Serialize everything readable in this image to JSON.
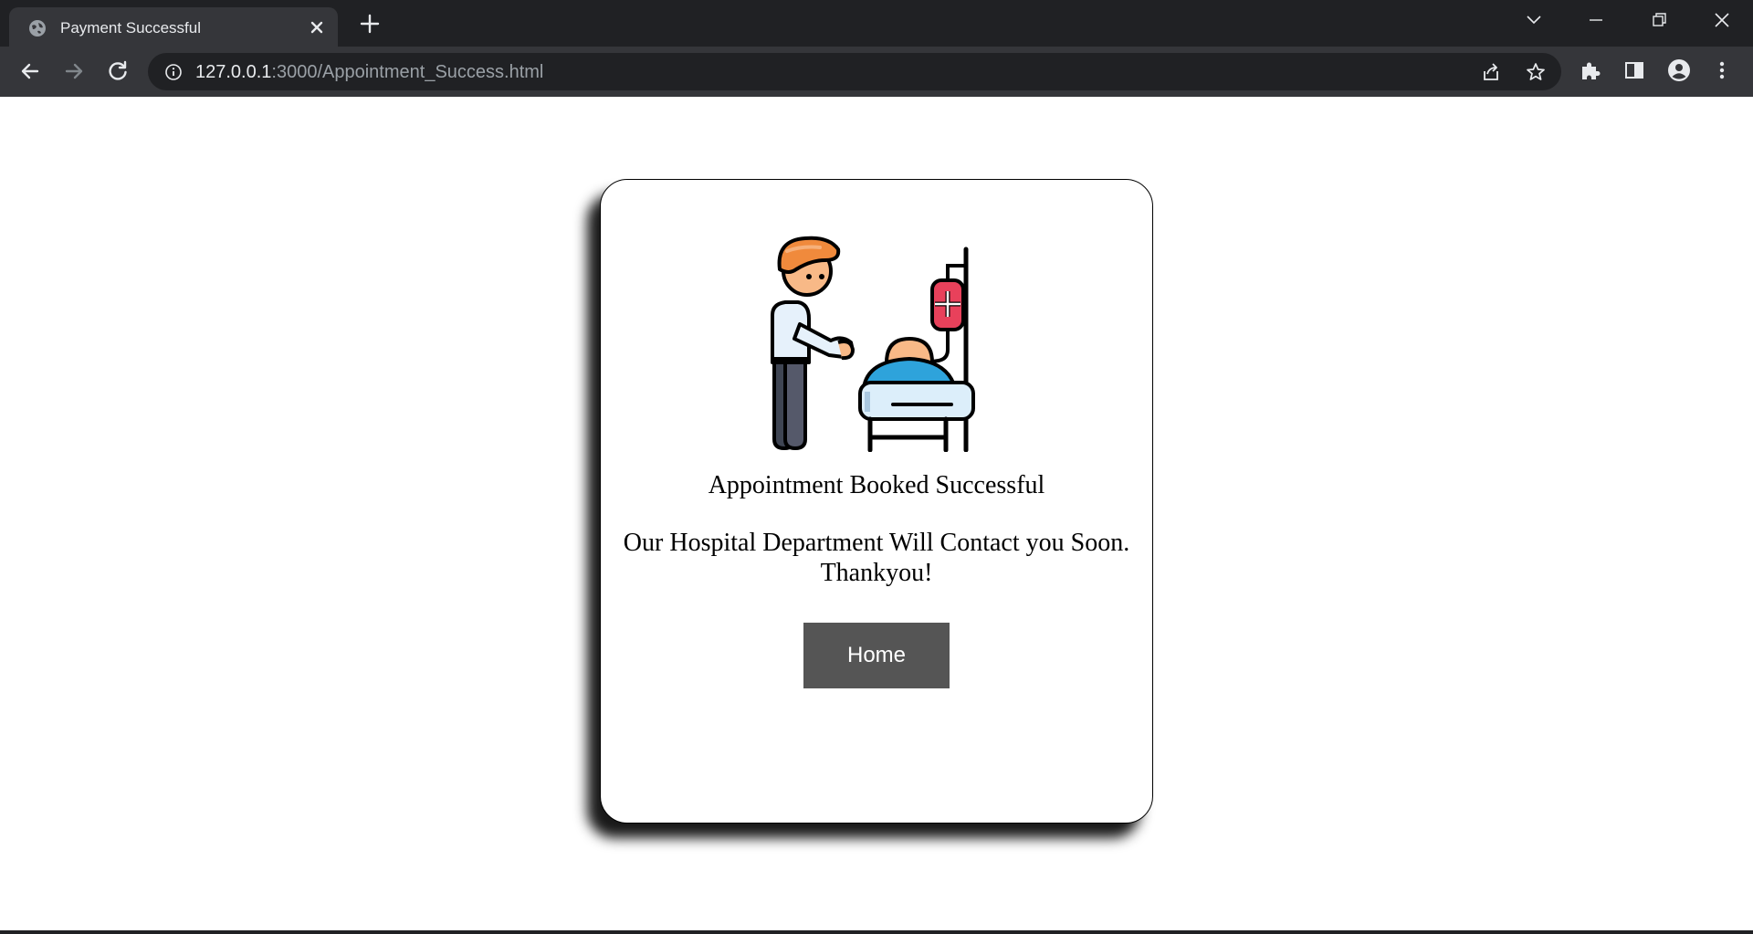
{
  "browser": {
    "tab_title": "Payment Successful",
    "url_host": "127.0.0.1",
    "url_path": ":3000/Appointment_Success.html",
    "icons": {
      "favicon": "globe-icon",
      "tab_close": "close-icon",
      "new_tab": "plus-icon",
      "back": "back-arrow-icon",
      "forward": "forward-arrow-icon",
      "reload": "reload-icon",
      "site_info": "info-icon",
      "share": "share-icon",
      "bookmark": "star-icon",
      "extensions": "puzzle-icon",
      "side_panel": "side-panel-icon",
      "profile": "profile-icon",
      "menu": "kebab-menu-icon"
    }
  },
  "card": {
    "title": "Appointment Booked Successful",
    "message_line1": "Our Hospital Department Will Contact you Soon.",
    "message_line2": "Thankyou!",
    "home_button": "Home",
    "illustration": "doctor-patient-bed-iv-icon"
  },
  "colors": {
    "button_bg": "#555555",
    "iv_bag": "#e8415b",
    "hair": "#f08a3c",
    "blanket": "#2ea3db"
  }
}
